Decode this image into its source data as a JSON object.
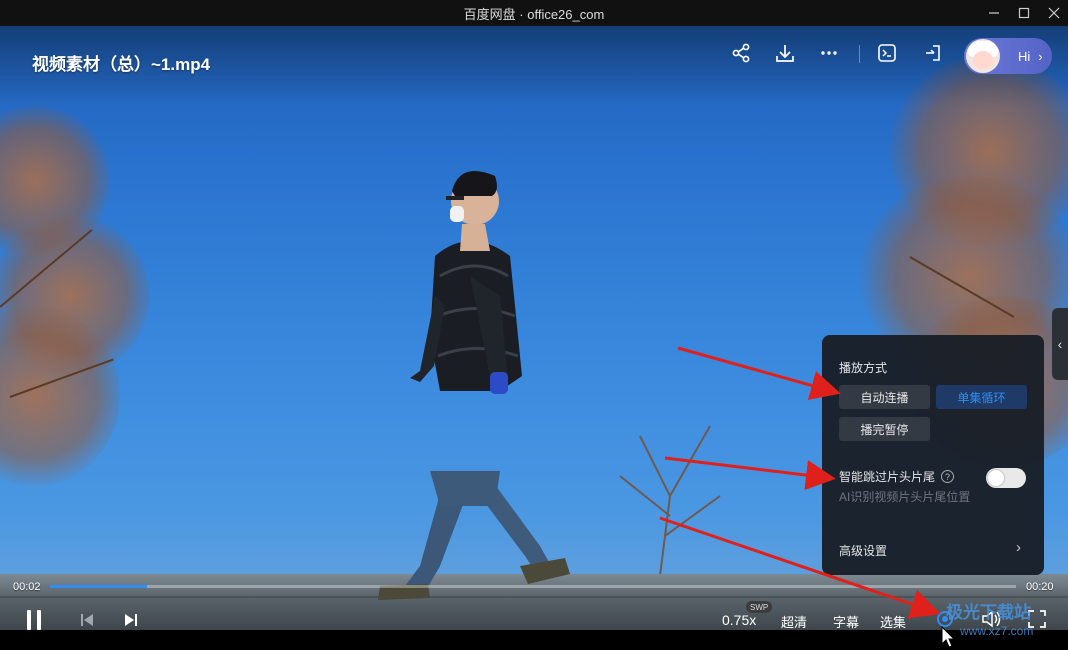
{
  "window": {
    "title": "百度网盘 · office26_com"
  },
  "player": {
    "video_title": "视频素材（总）~1.mp4",
    "hi_label": "Hi",
    "time_current": "00:02",
    "time_total": "00:20",
    "progress_fraction": 0.1,
    "speed_label": "0.75x",
    "swp_badge": "SWP",
    "quality_label": "超清",
    "subtitle_label": "字幕",
    "episodes_label": "选集"
  },
  "settings_popup": {
    "play_mode_title": "播放方式",
    "play_modes": [
      {
        "label": "自动连播",
        "selected": false
      },
      {
        "label": "单集循环",
        "selected": true
      },
      {
        "label": "播完暂停",
        "selected": false
      }
    ],
    "smart_skip_label": "智能跳过片头片尾",
    "smart_skip_help": "?",
    "smart_skip_sub": "AI识别视频片头片尾位置",
    "smart_skip_enabled": false,
    "advanced_label": "高级设置"
  },
  "watermark": {
    "main": "极光下载站",
    "url": "www.xz7.com"
  },
  "colors": {
    "accent": "#2f8df3",
    "annotation": "#e0201b"
  },
  "icons": [
    "share-icon",
    "download-icon",
    "more-icon",
    "screen-cast-icon",
    "picture-in-picture-icon",
    "pause-icon",
    "prev-icon",
    "next-icon",
    "settings-icon",
    "volume-icon",
    "fullscreen-icon"
  ]
}
